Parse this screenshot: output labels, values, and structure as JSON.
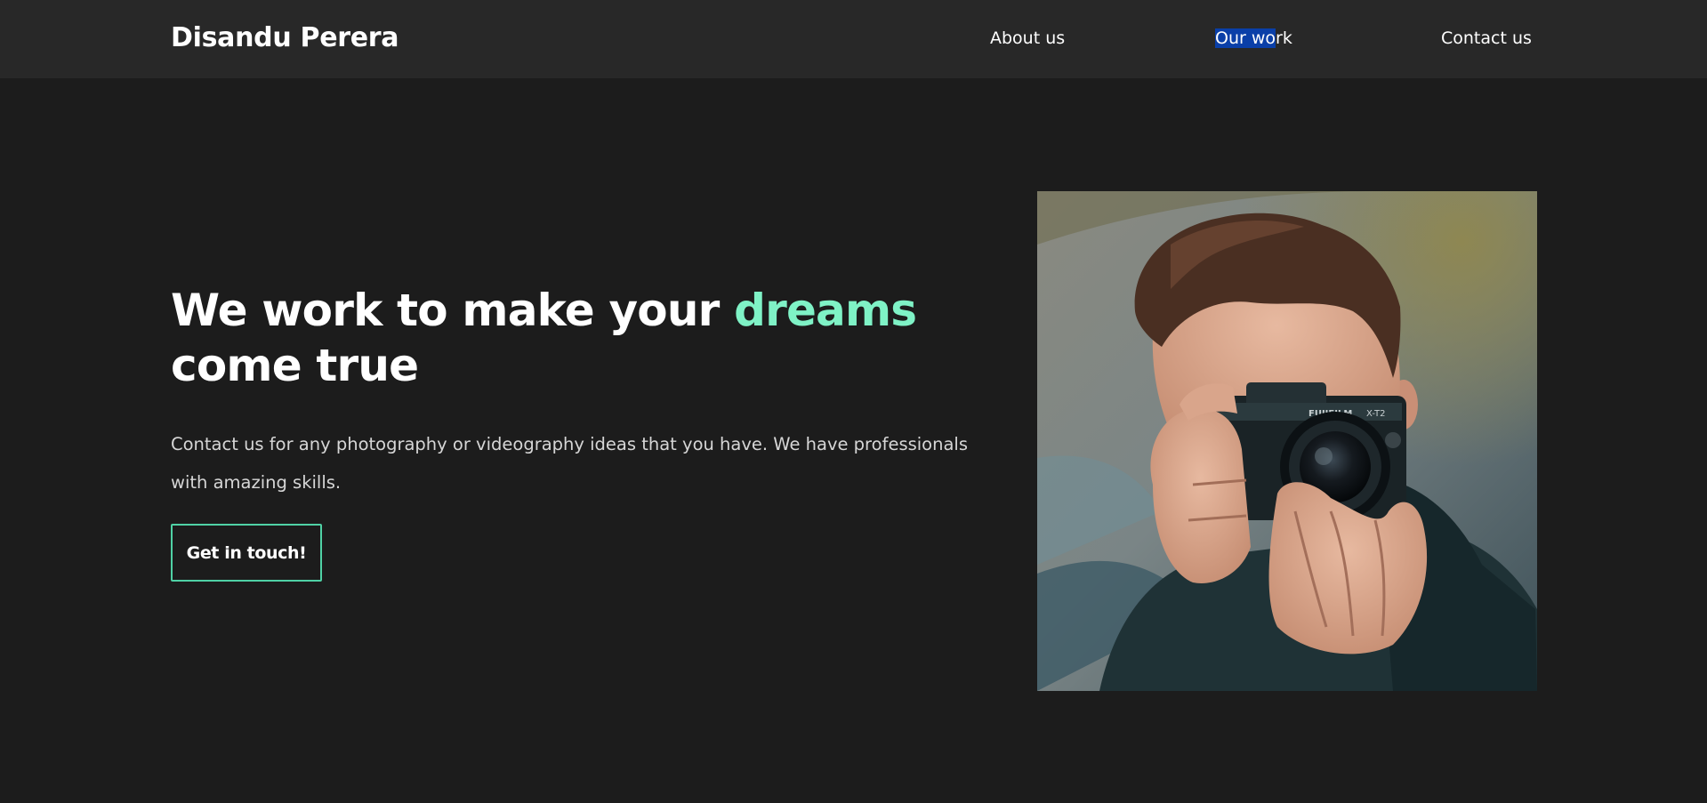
{
  "header": {
    "brand": "Disandu Perera",
    "nav": {
      "about": "About us",
      "work_selected": "Our wo",
      "work_rest": "rk",
      "contact": "Contact us"
    }
  },
  "hero": {
    "title_before": "We work to make your ",
    "title_accent": "dreams",
    "title_after": " come true",
    "description": "Contact us for any photography or videography ideas that you have. We have professionals with amazing skills.",
    "cta_label": "Get in touch!",
    "camera_brand": "FUJIFILM",
    "camera_model": "X-T2"
  },
  "colors": {
    "background": "#1c1c1c",
    "navbar": "#282828",
    "accent": "#7ff2c6",
    "button_border": "#4fd1a5",
    "selection": "#0a3fa8"
  }
}
